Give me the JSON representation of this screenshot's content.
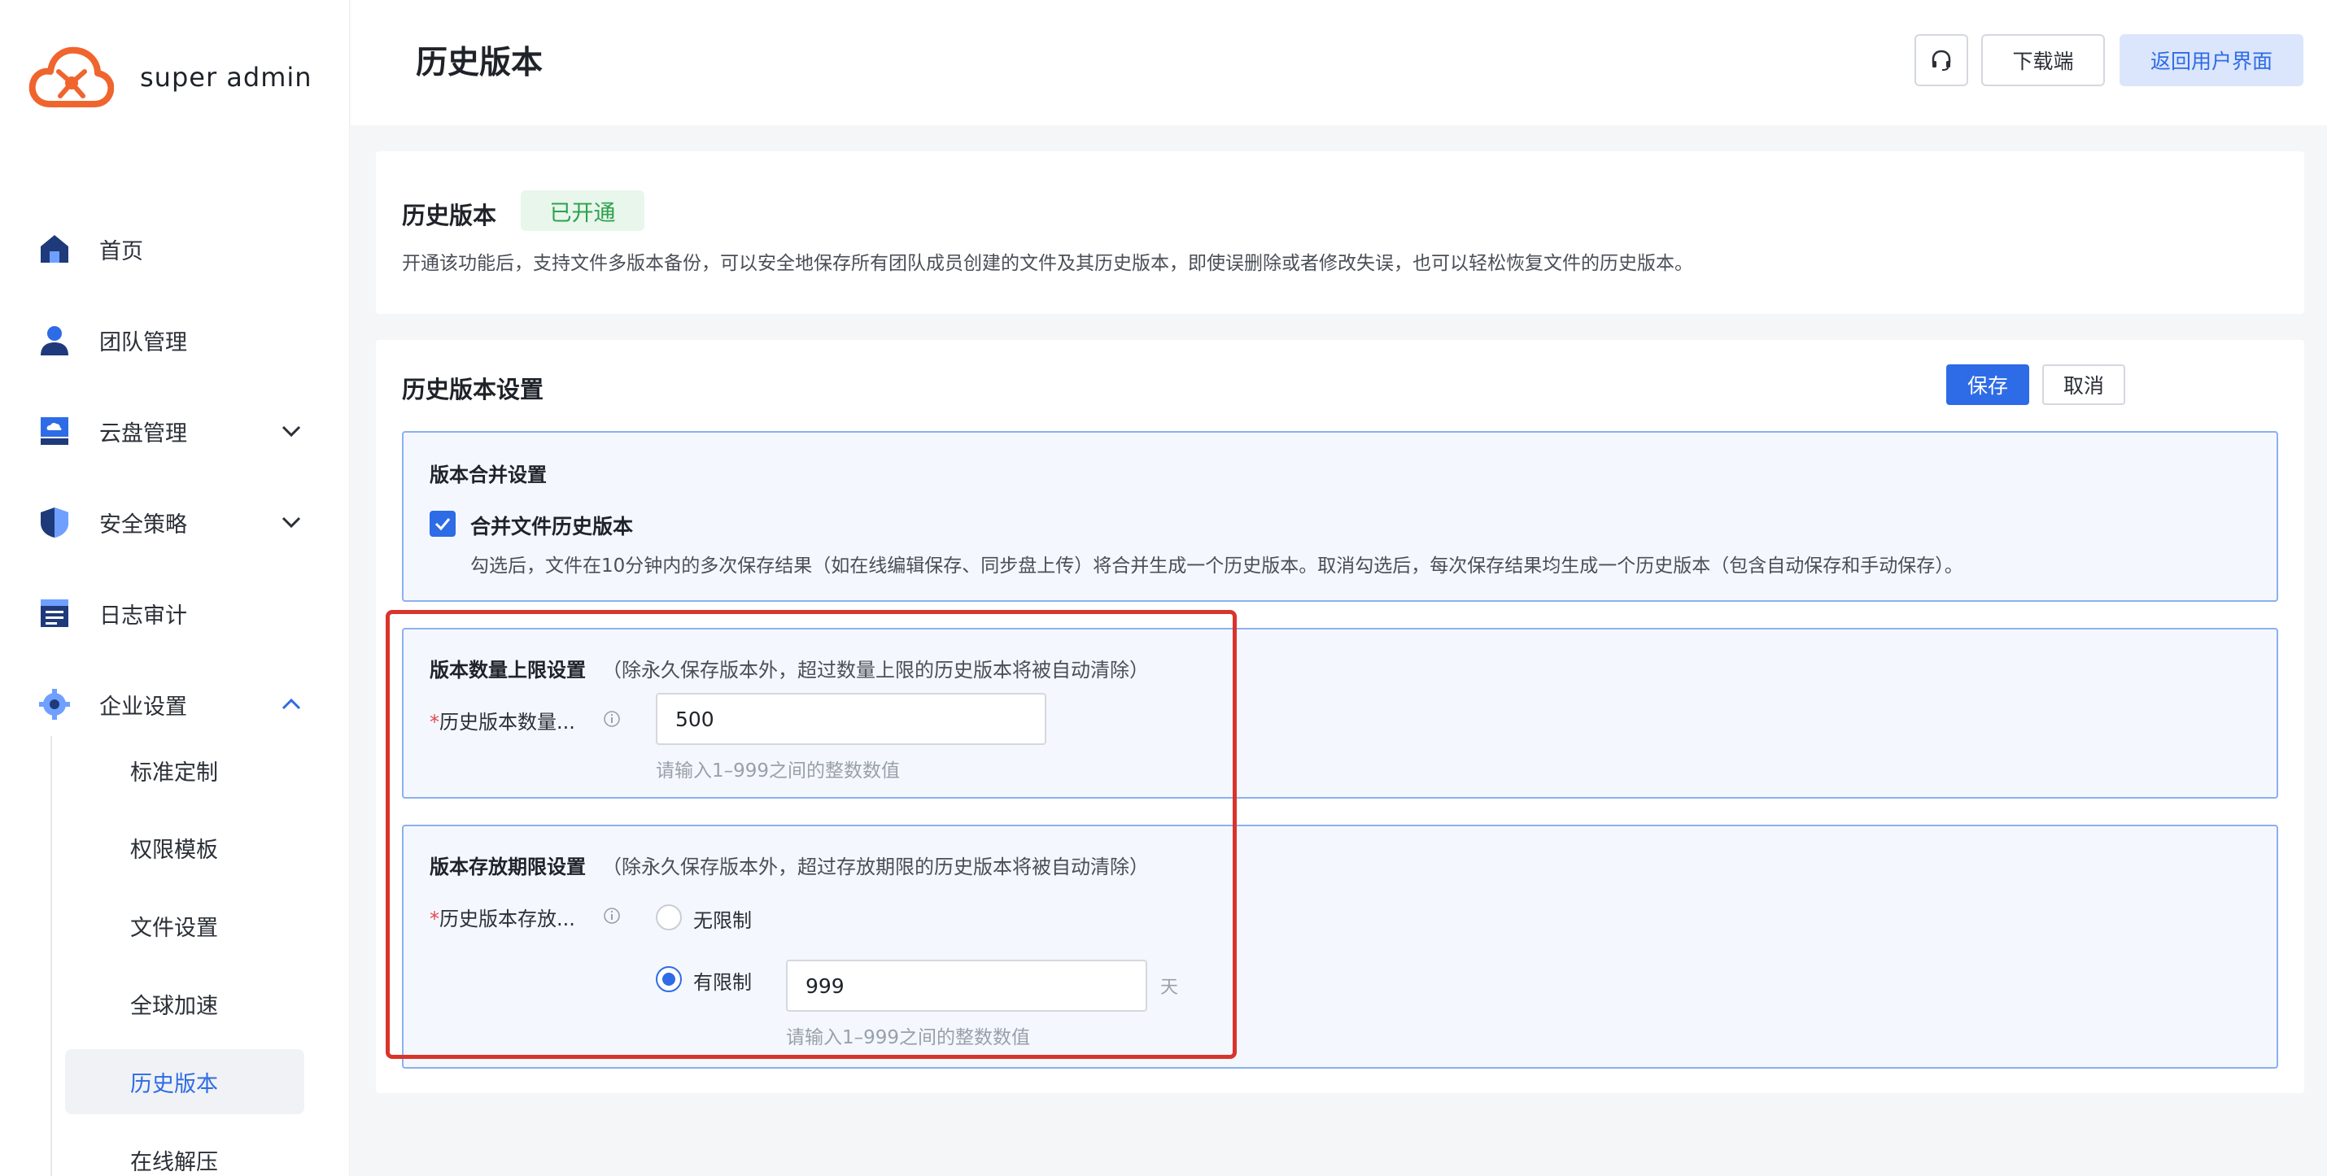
{
  "brand": {
    "name": "super admin",
    "logo_color": "#f0642e"
  },
  "sidebar": {
    "items": [
      {
        "label": "首页",
        "icon": "home-icon"
      },
      {
        "label": "团队管理",
        "icon": "user-icon"
      },
      {
        "label": "云盘管理",
        "icon": "cloud-disk-icon"
      },
      {
        "label": "安全策略",
        "icon": "shield-icon"
      },
      {
        "label": "日志审计",
        "icon": "log-icon"
      },
      {
        "label": "企业设置",
        "icon": "gear-icon"
      }
    ],
    "sub_items": [
      {
        "label": "标准定制"
      },
      {
        "label": "权限模板"
      },
      {
        "label": "文件设置"
      },
      {
        "label": "全球加速"
      },
      {
        "label": "历史版本"
      },
      {
        "label": "在线解压"
      }
    ]
  },
  "header": {
    "title": "历史版本",
    "download_label": "下载端",
    "return_label": "返回用户界面"
  },
  "status_card": {
    "title": "历史版本",
    "badge": "已开通",
    "description": "开通该功能后，支持文件多版本备份，可以安全地保存所有团队成员创建的文件及其历史版本，即使误删除或者修改失误，也可以轻松恢复文件的历史版本。"
  },
  "settings": {
    "title": "历史版本设置",
    "save_label": "保存",
    "cancel_label": "取消",
    "merge": {
      "title": "版本合并设置",
      "checkbox_label": "合并文件历史版本",
      "checked": true,
      "description": "勾选后，文件在10分钟内的多次保存结果（如在线编辑保存、同步盘上传）将合并生成一个历史版本。取消勾选后，每次保存结果均生成一个历史版本（包含自动保存和手动保存）。"
    },
    "count_limit": {
      "title": "版本数量上限设置",
      "note": "（除永久保存版本外，超过数量上限的历史版本将被自动清除）",
      "required_mark": "*",
      "field_label": "历史版本数量...",
      "value": "500",
      "hint": "请输入1–999之间的整数数值"
    },
    "period_limit": {
      "title": "版本存放期限设置",
      "note": "（除永久保存版本外，超过存放期限的历史版本将被自动清除）",
      "required_mark": "*",
      "field_label": "历史版本存放...",
      "option_unlimited": "无限制",
      "option_limited": "有限制",
      "selected": "有限制",
      "value": "999",
      "unit": "天",
      "hint": "请输入1–999之间的整数数值"
    }
  },
  "colors": {
    "primary": "#2e6be6",
    "success": "#2ca24c",
    "highlight": "#d9342b"
  }
}
